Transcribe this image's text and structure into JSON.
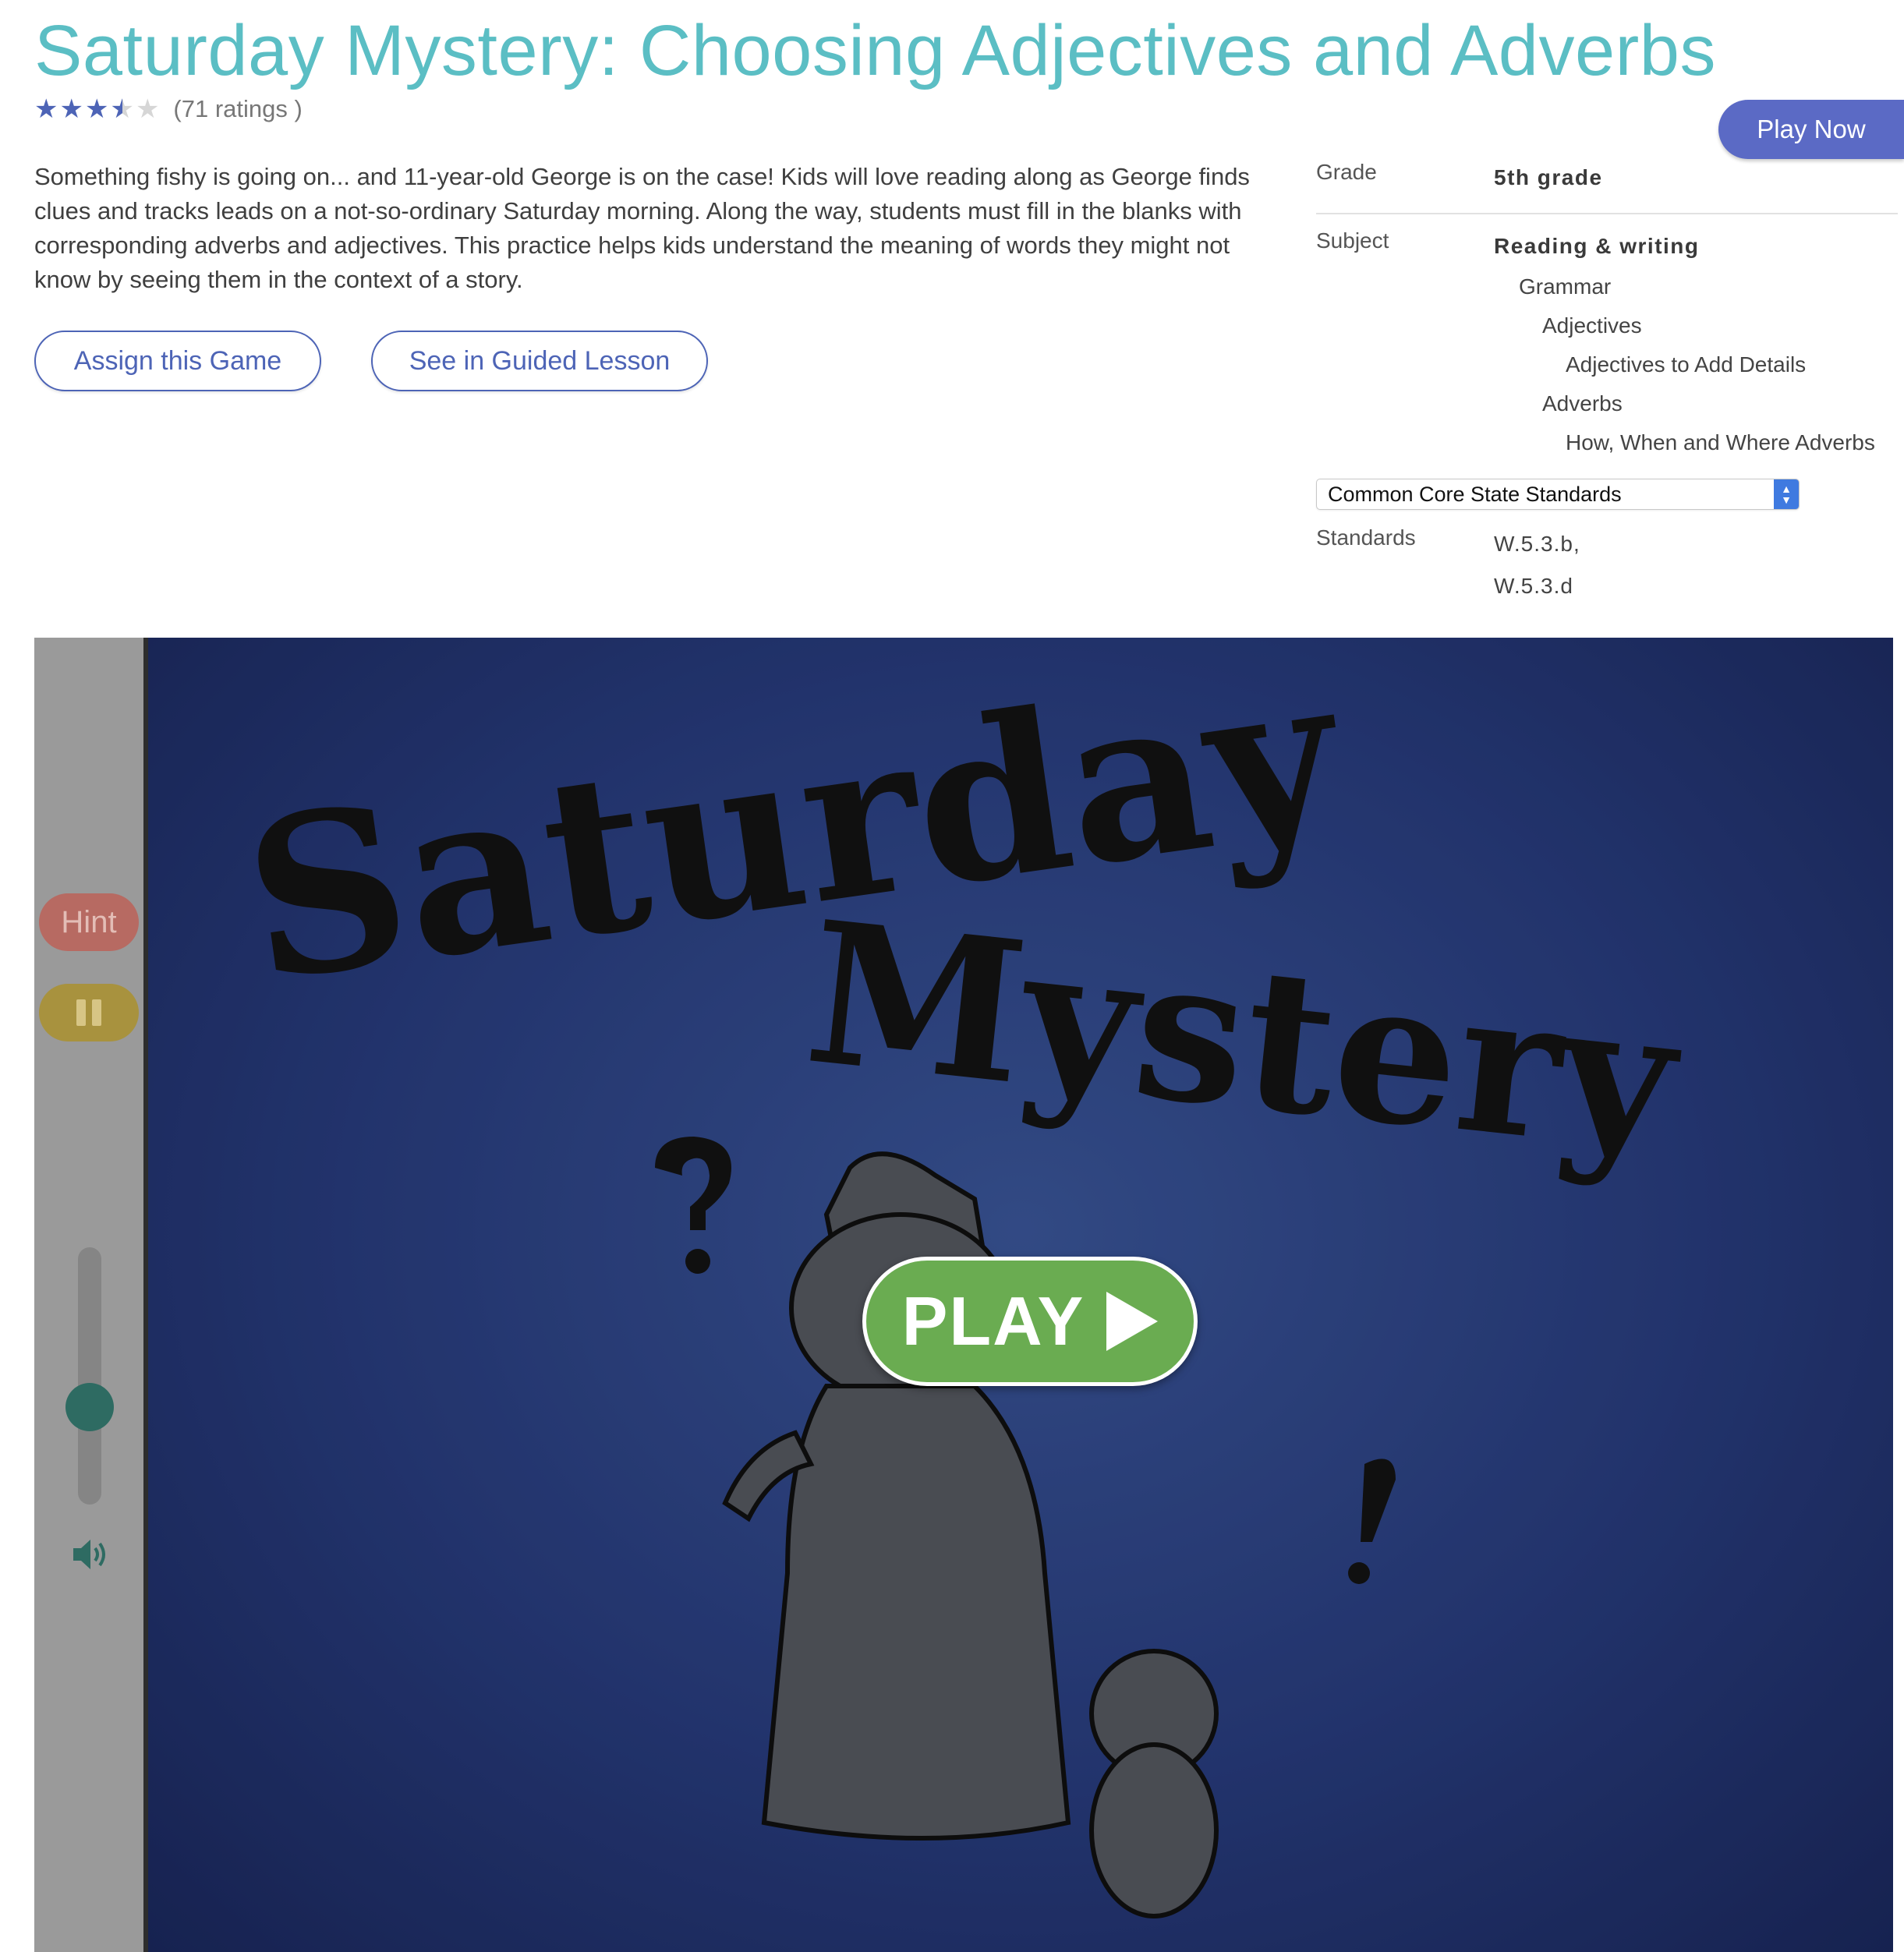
{
  "page": {
    "title": "Saturday Mystery: Choosing Adjectives and Adverbs",
    "rating": {
      "stars": 3.5,
      "max_stars": 5,
      "count_text": "(71 ratings )"
    },
    "play_now_label": "Play Now",
    "description": "Something fishy is going on... and 11-year-old George is on the case! Kids will love reading along as George finds clues and tracks leads on a not-so-ordinary Saturday morning. Along the way, students must fill in the blanks with corresponding adverbs and adjectives. This practice helps kids understand the meaning of words they might not know by seeing them in the context of a story.",
    "buttons": {
      "assign": "Assign this Game",
      "guided": "See in Guided Lesson"
    },
    "colors": {
      "title": "#5bbec4",
      "accent": "#4d64b6",
      "play_now": "#5b6ac5",
      "play_game": "#6aac51"
    }
  },
  "meta": {
    "grade_label": "Grade",
    "grade_value": "5th grade",
    "subject_label": "Subject",
    "subject_value": "Reading & writing",
    "subject_tree": [
      "Grammar",
      "Adjectives",
      "Adjectives to Add Details",
      "Adverbs",
      "How, When and Where Adverbs"
    ],
    "standards_select": "Common Core State Standards",
    "standards_label": "Standards",
    "standards": [
      "W.5.3.b,",
      "W.5.3.d"
    ]
  },
  "game": {
    "hint_label": "Hint",
    "title_line1": "Saturday",
    "title_line2": "Mystery",
    "play_label": "PLAY",
    "volume_level": 0.35,
    "icons": [
      "pause-icon",
      "volume-icon",
      "play-triangle-icon"
    ]
  }
}
